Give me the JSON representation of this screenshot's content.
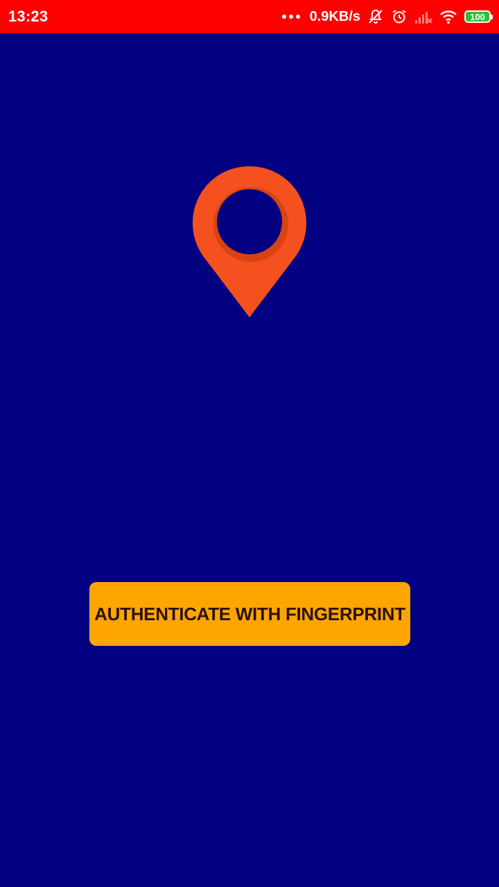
{
  "status_bar": {
    "time": "13:23",
    "network_speed": "0.9KB/s",
    "battery_level": "100",
    "icons": [
      "more-dots-icon",
      "notifications-off-icon",
      "alarm-icon",
      "signal-off-icon",
      "wifi-icon",
      "battery-icon"
    ],
    "background_color": "#ff0000"
  },
  "main": {
    "background_color": "#000080",
    "logo_icon": "location-pin-icon",
    "logo_color": "#f4511e",
    "auth_button_label": "AUTHENTICATE WITH FINGERPRINT",
    "auth_button_color": "#ffa500"
  }
}
